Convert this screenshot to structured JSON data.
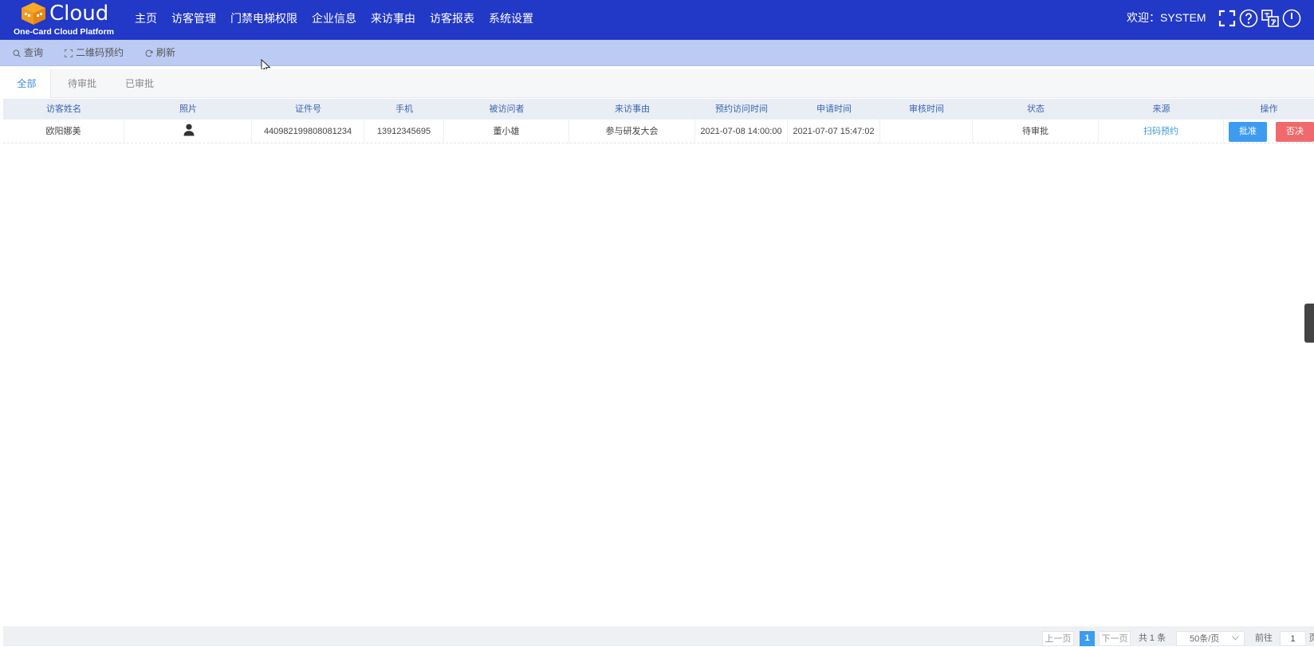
{
  "header": {
    "logo_word": "Cloud",
    "logo_subtitle": "One-Card Cloud Platform",
    "nav": [
      "主页",
      "访客管理",
      "门禁电梯权限",
      "企业信息",
      "来访事由",
      "访客报表",
      "系统设置"
    ],
    "welcome": "欢迎：SYSTEM",
    "icons": [
      "fullscreen-icon",
      "help-icon",
      "language-icon",
      "power-icon"
    ]
  },
  "toolbar": {
    "query": "查询",
    "qrcode": "二维码预约",
    "refresh": "刷新"
  },
  "tabs": [
    "全部",
    "待审批",
    "已审批"
  ],
  "table": {
    "columns": [
      "访客姓名",
      "照片",
      "证件号",
      "手机",
      "被访问者",
      "来访事由",
      "预约访问时间",
      "申请时间",
      "审核时间",
      "状态",
      "来源",
      "操作"
    ],
    "rows": [
      {
        "name": "欧阳娜美",
        "photo": "user-icon",
        "id_no": "440982199808081234",
        "phone": "13912345695",
        "host": "董小雄",
        "reason": "参与研发大会",
        "appointment": "2021-07-08 14:00:00",
        "applied": "2021-07-07 15:47:02",
        "reviewed": "",
        "status": "待审批",
        "source": "扫码预约",
        "approve": "批准",
        "reject": "否决"
      }
    ]
  },
  "pager": {
    "prev": "上一页",
    "current": "1",
    "next": "下一页",
    "total": "共 1 条",
    "page_size": "50条/页",
    "goto_label": "前往",
    "goto_value": "1",
    "goto_suffix": "页"
  },
  "colors": {
    "header_bg": "#2238c6",
    "toolbar_bg": "#bccbf4",
    "approve": "#3d9cf0",
    "reject": "#ef6a6c",
    "link": "#3b9bd6"
  }
}
